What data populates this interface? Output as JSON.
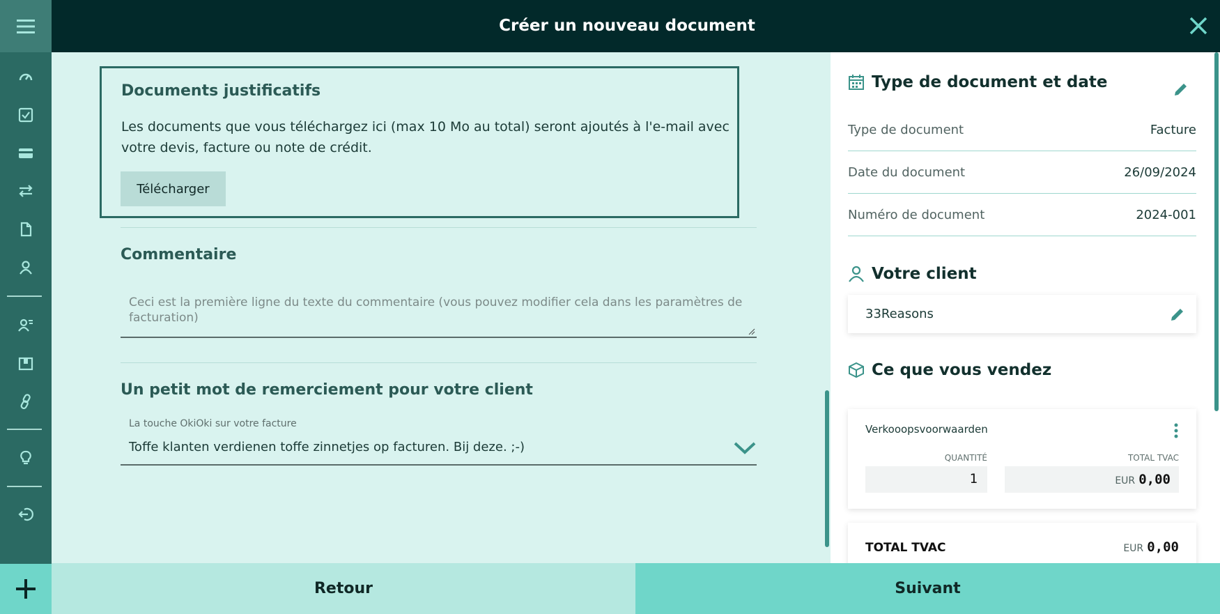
{
  "header": {
    "title": "Créer un nouveau document"
  },
  "sidebar": {
    "items": [
      {
        "icon": "speedometer-icon"
      },
      {
        "icon": "checkbox-icon"
      },
      {
        "icon": "credit-card-icon"
      },
      {
        "icon": "transfer-arrows-icon"
      },
      {
        "icon": "document-icon"
      },
      {
        "icon": "contact-icon"
      },
      {
        "icon": "user-list-icon"
      },
      {
        "icon": "products-icon"
      },
      {
        "icon": "link-icon"
      },
      {
        "icon": "lightbulb-icon"
      },
      {
        "icon": "logout-icon"
      }
    ]
  },
  "main": {
    "docs": {
      "title": "Documents justificatifs",
      "text": "Les documents que vous téléchargez ici (max 10 Mo au total) seront ajoutés à l'e-mail avec votre devis, facture ou note de crédit.",
      "upload_label": "Télécharger"
    },
    "comment": {
      "title": "Commentaire",
      "placeholder": "Ceci est la première ligne du texte du commentaire (vous pouvez modifier cela dans les paramètres de facturation)"
    },
    "thanks": {
      "title": "Un petit mot de remerciement pour votre client",
      "select_label": "La touche OkiOki sur votre facture",
      "select_value": "Toffe klanten verdienen toffe zinnetjes op facturen. Bij deze. ;-)"
    }
  },
  "panel": {
    "doc_section": {
      "title": "Type de document et date",
      "rows": [
        {
          "label": "Type de document",
          "value": "Facture"
        },
        {
          "label": "Date du document",
          "value": "26/09/2024"
        },
        {
          "label": "Numéro de document",
          "value": "2024-001"
        }
      ]
    },
    "client_section": {
      "title": "Votre client",
      "client_name": "33Reasons"
    },
    "sell_section": {
      "title": "Ce que vous vendez",
      "item": {
        "name": "Verkooopsvoorwaarden",
        "qty_label": "QUANTITÉ",
        "total_label": "TOTAL TVAC",
        "quantity": "1",
        "currency": "EUR",
        "amount": "0,00"
      },
      "total": {
        "label": "TOTAL TVAC",
        "currency": "EUR",
        "amount": "0,00"
      }
    }
  },
  "footer": {
    "back_label": "Retour",
    "next_label": "Suivant"
  },
  "colors": {
    "sidebar": "#2b6a63",
    "header": "#02292a",
    "main_bg": "#d9f3ef",
    "accent": "#6fd6c9",
    "back_button": "#b5e8e0"
  }
}
